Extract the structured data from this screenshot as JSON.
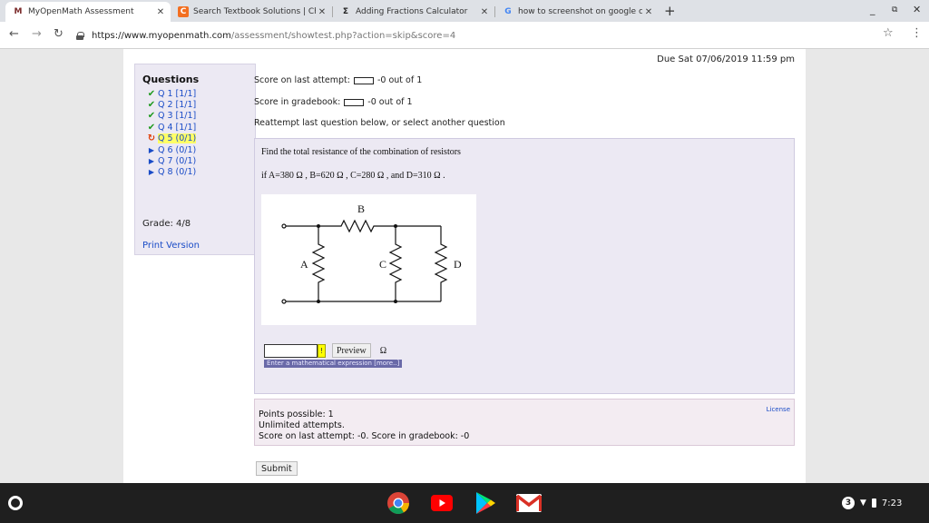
{
  "tabs": [
    {
      "title": "MyOpenMath Assessment",
      "favicon": "M",
      "active": true
    },
    {
      "title": "Search Textbook Solutions | Che",
      "favicon": "C",
      "active": false
    },
    {
      "title": "Adding Fractions Calculator",
      "favicon": "Σ",
      "active": false
    },
    {
      "title": "how to screenshot on google ch",
      "favicon": "G",
      "active": false
    }
  ],
  "address": {
    "host": "https://www.myopenmath.com",
    "path": "/assessment/showtest.php?action=skip&score=4"
  },
  "header": {
    "due": "Due Sat 07/06/2019 11:59 pm"
  },
  "sidebar": {
    "heading": "Questions",
    "questions": [
      {
        "label": "Q 1 [1/1]",
        "status": "correct"
      },
      {
        "label": "Q 2 [1/1]",
        "status": "correct"
      },
      {
        "label": "Q 3 [1/1]",
        "status": "correct"
      },
      {
        "label": "Q 4 [1/1]",
        "status": "correct"
      },
      {
        "label": "Q 5 (0/1)",
        "status": "current"
      },
      {
        "label": "Q 6 (0/1)",
        "status": "pending"
      },
      {
        "label": "Q 7 (0/1)",
        "status": "pending"
      },
      {
        "label": "Q 8 (0/1)",
        "status": "pending"
      }
    ],
    "grade": "Grade: 4/8",
    "print_version": "Print Version"
  },
  "scores": {
    "last_attempt_label": "Score on last attempt:",
    "last_attempt_value": "-0 out of 1",
    "gradebook_label": "Score in gradebook:",
    "gradebook_value": "-0 out of 1",
    "reattempt": "Reattempt last question below, or select another question"
  },
  "question": {
    "prompt": "Find the total resistance of the combination of resistors",
    "values": "if A=380 Ω ,  B=620 Ω ,  C=280 Ω ,   and D=310 Ω .",
    "figure_labels": {
      "a": "A",
      "b": "B",
      "c": "C",
      "d": "D"
    },
    "preview_label": "Preview",
    "unit": "Ω",
    "warn_glyph": "!",
    "hint": "Enter a mathematical expression [more..]"
  },
  "info": {
    "points": "Points possible: 1",
    "attempts": "Unlimited attempts.",
    "score_line": "Score on last attempt: -0. Score in gradebook: -0",
    "license": "License"
  },
  "submit_label": "Submit",
  "system": {
    "notification_count": "3",
    "time": "7:23"
  }
}
